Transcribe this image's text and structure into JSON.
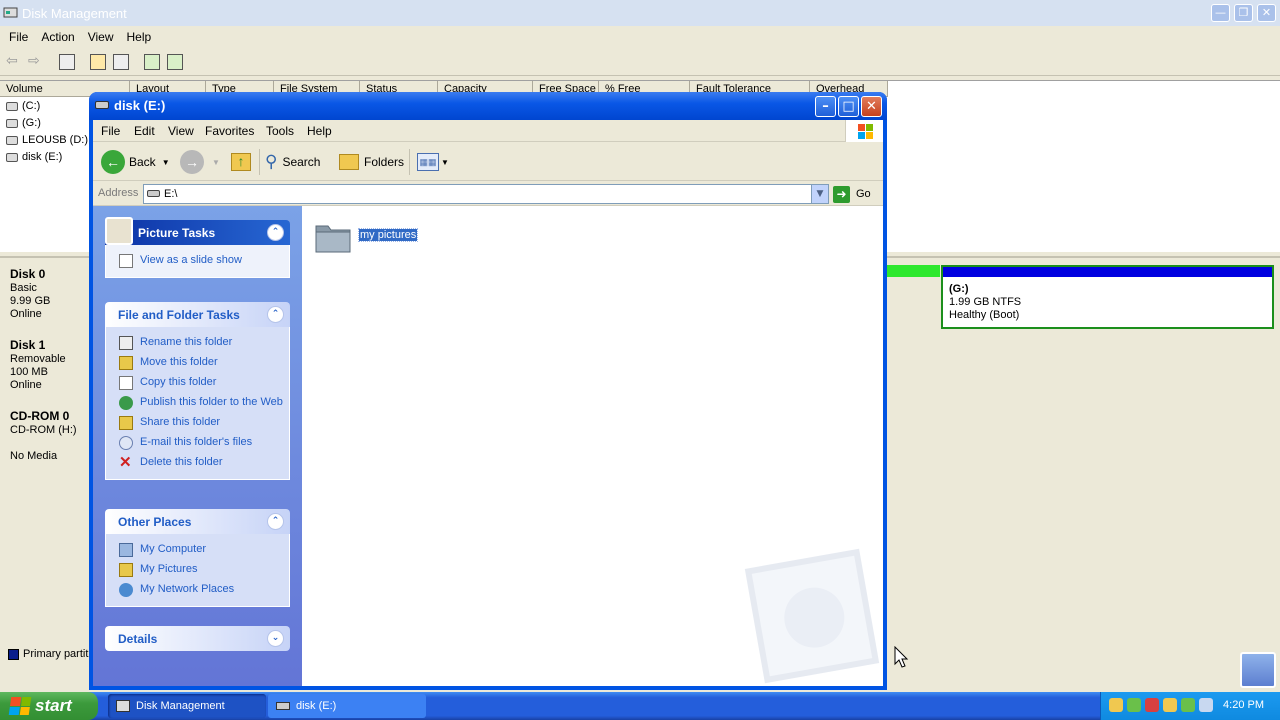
{
  "disk_management": {
    "title": "Disk Management",
    "menu": [
      "File",
      "Action",
      "View",
      "Help"
    ],
    "columns": [
      "Volume",
      "Layout",
      "Type",
      "File System",
      "Status",
      "Capacity",
      "Free Space",
      "% Free",
      "Fault Tolerance",
      "Overhead"
    ],
    "volumes": [
      "(C:)",
      "(G:)",
      "LEOUSB (D:)",
      "disk (E:)"
    ],
    "disks": [
      {
        "name": "Disk 0",
        "lines": [
          "Basic",
          "9.99 GB",
          "Online"
        ]
      },
      {
        "name": "Disk 1",
        "lines": [
          "Removable",
          "100 MB",
          "Online"
        ]
      },
      {
        "name": "CD-ROM 0",
        "lines": [
          "CD-ROM (H:)",
          "",
          "No Media"
        ]
      }
    ],
    "partition_g": {
      "name": "(G:)",
      "size": "1.99 GB NTFS",
      "status": "Healthy (Boot)"
    },
    "legend": "Primary partition"
  },
  "explorer": {
    "title": "disk (E:)",
    "menu": [
      "File",
      "Edit",
      "View",
      "Favorites",
      "Tools",
      "Help"
    ],
    "toolbar": {
      "back": "Back",
      "search": "Search",
      "folders": "Folders"
    },
    "address_label": "Address",
    "address_value": "E:\\",
    "go_label": "Go",
    "panels": {
      "picture_tasks": {
        "title": "Picture Tasks",
        "items": [
          "View as a slide show"
        ]
      },
      "file_folder_tasks": {
        "title": "File and Folder Tasks",
        "items": [
          "Rename this folder",
          "Move this folder",
          "Copy this folder",
          "Publish this folder to the Web",
          "Share this folder",
          "E-mail this folder's files",
          "Delete this folder"
        ]
      },
      "other_places": {
        "title": "Other Places",
        "items": [
          "My Computer",
          "My Pictures",
          "My Network Places"
        ]
      },
      "details": {
        "title": "Details"
      }
    },
    "folder_name": "my pictures"
  },
  "taskbar": {
    "start": "start",
    "tasks": [
      "Disk Management",
      "disk (E:)"
    ],
    "clock": "4:20 PM"
  }
}
